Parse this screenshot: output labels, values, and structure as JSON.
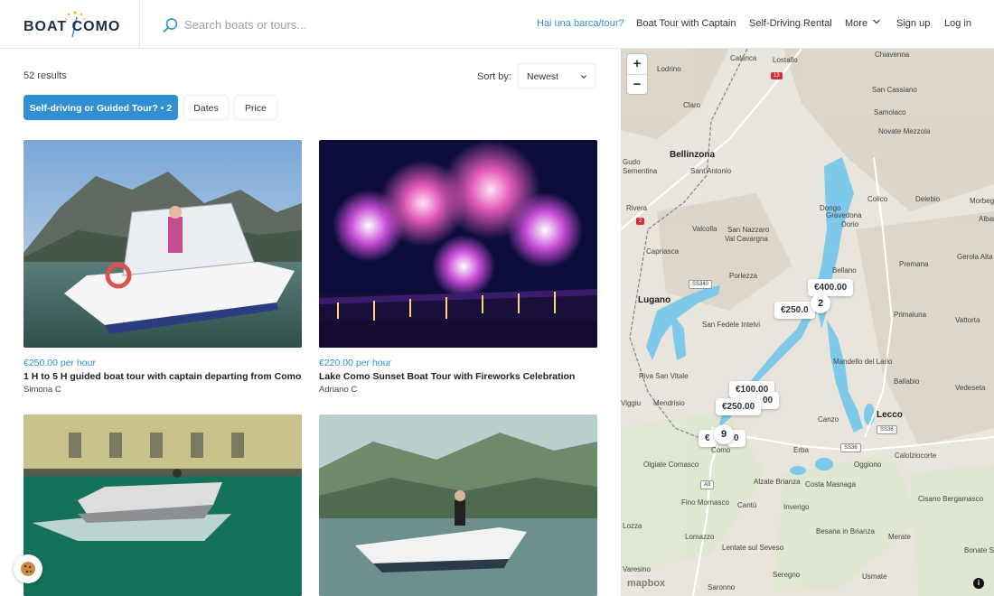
{
  "brand": {
    "logo_text": "BOAT COMO"
  },
  "search": {
    "placeholder": "Search boats or tours..."
  },
  "nav": {
    "list_cta": "Hai una barca/tour?",
    "boat_tour": "Boat Tour with Captain",
    "self_driving": "Self-Driving Rental",
    "more": "More",
    "signup": "Sign up",
    "login": "Log in"
  },
  "results": {
    "count": "52 results"
  },
  "sort": {
    "label": "Sort by:",
    "value": "Newest"
  },
  "filters": {
    "type": "Self-driving or Guided Tour? • 2",
    "dates": "Dates",
    "price": "Price"
  },
  "listings": [
    {
      "price": "€250.00 per hour",
      "title": "1 H to 5 H guided boat tour with captain departing from Como",
      "owner": "Simona C"
    },
    {
      "price": "€220.00 per hour",
      "title": "Lake Como Sunset Boat Tour with Fireworks Celebration",
      "owner": "Adriano C"
    }
  ],
  "map": {
    "zoom_in": "+",
    "zoom_out": "−",
    "attribution": "mapbox",
    "info": "i",
    "price_pins": [
      "€400.00",
      "€250.0",
      "€100.00",
      "00",
      "€250.00",
      "€",
      "0"
    ],
    "clusters": [
      "2",
      "9"
    ],
    "road_labels": [
      "13",
      "2",
      "SS340",
      "A9",
      "SS36",
      "SS36"
    ],
    "places": [
      "Chiavenna",
      "Calanca",
      "Lostallo",
      "Lodrino",
      "San Cassiano",
      "Samolaco",
      "Claro",
      "Novate Mezzola",
      "Bellinzona",
      "Sant'Antonio",
      "Gudo",
      "Sementina",
      "Gravedona",
      "Colico",
      "Delebio",
      "Morbeg",
      "Rivera",
      "Dongo",
      "Albaredo",
      "Valcolla",
      "San Nazzaro",
      "Val Cavargna",
      "Dorio",
      "Capriasca",
      "Premana",
      "Gerola Alta",
      "Porlezza",
      "Bellano",
      "Lugano",
      "Vattorta",
      "San Fedele Intelvi",
      "Primaluna",
      "Riva San Vitale",
      "Mandello del Lario",
      "Viggiu",
      "Mendrisio",
      "Ballabio",
      "Vedeseta",
      "Canzo",
      "Lecco",
      "Olgiate Comasco",
      "Erba",
      "Calolziocorte",
      "Oggiono",
      "Alzate Brianza",
      "Costa Masnaga",
      "Fino Mornasco",
      "Cantù",
      "Inverigo",
      "Cisano Bergamasco",
      "Lomazzo",
      "Besana in Brianza",
      "Merate",
      "Lentate sul Seveso",
      "Seregno",
      "Usmate",
      "Saronno",
      "Bonate Sop",
      "Varesino",
      "Lozza",
      "Como"
    ]
  }
}
